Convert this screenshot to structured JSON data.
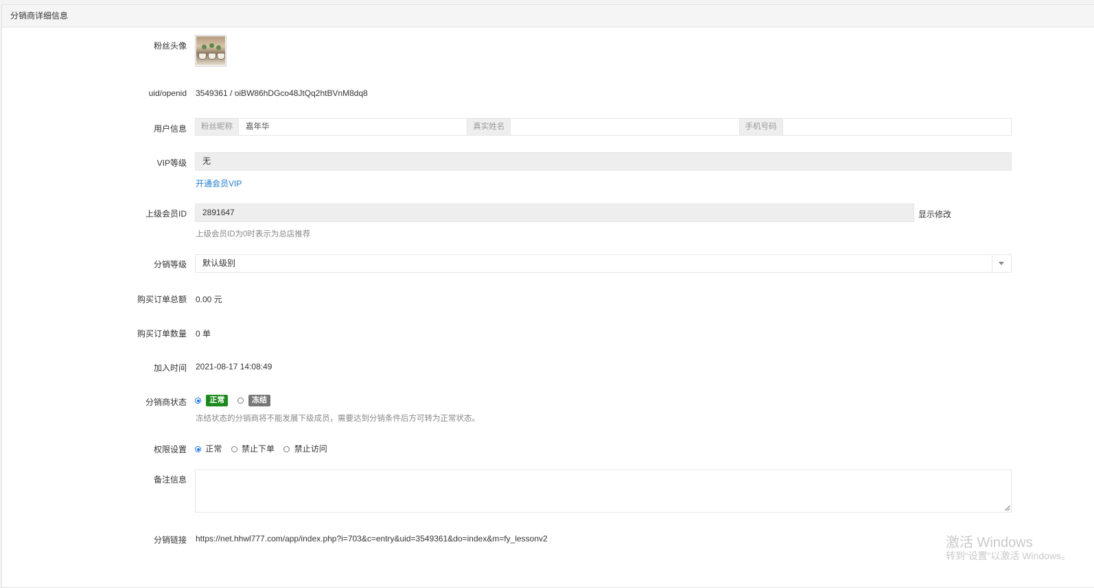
{
  "panel": {
    "title": "分销商详细信息"
  },
  "form": {
    "avatar": {
      "label": "粉丝头像"
    },
    "uid_openid": {
      "label": "uid/openid",
      "value": "3549361 / oiBW86hDGco48JtQq2htBVnM8dq8"
    },
    "user_info": {
      "label": "用户信息",
      "nickname_addon": "粉丝昵称",
      "nickname_value": "嘉年华",
      "realname_addon": "真实姓名",
      "realname_value": "",
      "phone_addon": "手机号码",
      "phone_value": ""
    },
    "vip": {
      "label": "VIP等级",
      "value": "无",
      "link": "开通会员VIP"
    },
    "parent": {
      "label": "上级会员ID",
      "value": "2891647",
      "action": "显示修改",
      "help": "上级会员ID为0时表示为总店推荐"
    },
    "level": {
      "label": "分销等级",
      "value": "默认级别"
    },
    "order_total": {
      "label": "购买订单总额",
      "value": "0.00 元"
    },
    "order_count": {
      "label": "购买订单数量",
      "value": "0 单"
    },
    "join_time": {
      "label": "加入时间",
      "value": "2021-08-17 14:08:49"
    },
    "status": {
      "label": "分销商状态",
      "options": [
        "正常",
        "冻结"
      ],
      "selected": "正常",
      "colors": {
        "normal": "#1c8a1c",
        "frozen": "#777777"
      },
      "help": "冻结状态的分销商将不能发展下级成员，需要达到分销条件后方可转为正常状态。"
    },
    "permission": {
      "label": "权限设置",
      "options": [
        "正常",
        "禁止下单",
        "禁止访问"
      ],
      "selected": "正常"
    },
    "remark": {
      "label": "备注信息",
      "value": ""
    },
    "link": {
      "label": "分销链接",
      "value": "https://net.hhwl777.com/app/index.php?i=703&c=entry&uid=3549361&do=index&m=fy_lessonv2"
    }
  },
  "watermark": {
    "line1": "激活 Windows",
    "line2": "转到“设置”以激活 Windows。"
  }
}
